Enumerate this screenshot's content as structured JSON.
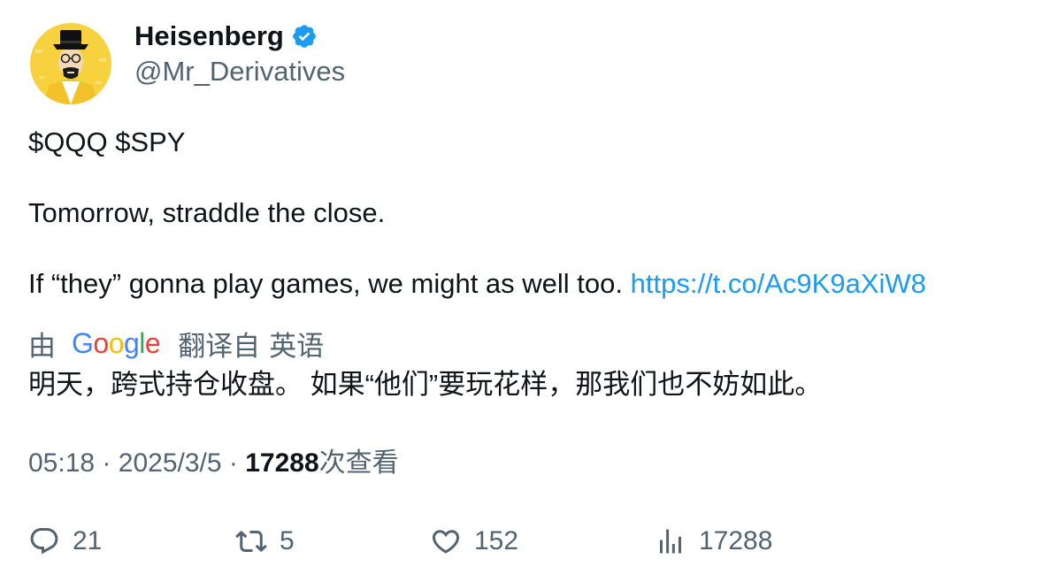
{
  "author": {
    "display_name": "Heisenberg",
    "handle": "@Mr_Derivatives",
    "avatar_icon": "heisenberg-avatar",
    "verified_icon": "verified-badge-icon",
    "verified_color": "#1d9bf0"
  },
  "tweet": {
    "line1": "$QQQ $SPY",
    "line2": "Tomorrow, straddle the close.",
    "line3_text": "If “they” gonna play games, we might as well too.",
    "link": "https://t.co/Ac9K9aXiW8"
  },
  "translation": {
    "prefix": "由",
    "provider": [
      "G",
      "o",
      "o",
      "g",
      "l",
      "e"
    ],
    "provider_colors": [
      "#4285F4",
      "#EA4335",
      "#FBBC05",
      "#4285F4",
      "#34A853",
      "#EA4335"
    ],
    "label": "翻译自",
    "source_language": "英语",
    "text": "明天，跨式持仓收盘。 如果“他们”要玩花样，那我们也不妨如此。"
  },
  "meta": {
    "time": "05:18",
    "separator": "·",
    "date": "2025/3/5",
    "views": "17288",
    "views_label": "次查看"
  },
  "actions": {
    "replies": "21",
    "retweets": "5",
    "likes": "152",
    "views": "17288"
  },
  "colors": {
    "text": "#0f1419",
    "secondary": "#536471",
    "link": "#1d9bf0",
    "avatar_bg": "#f5c518"
  }
}
